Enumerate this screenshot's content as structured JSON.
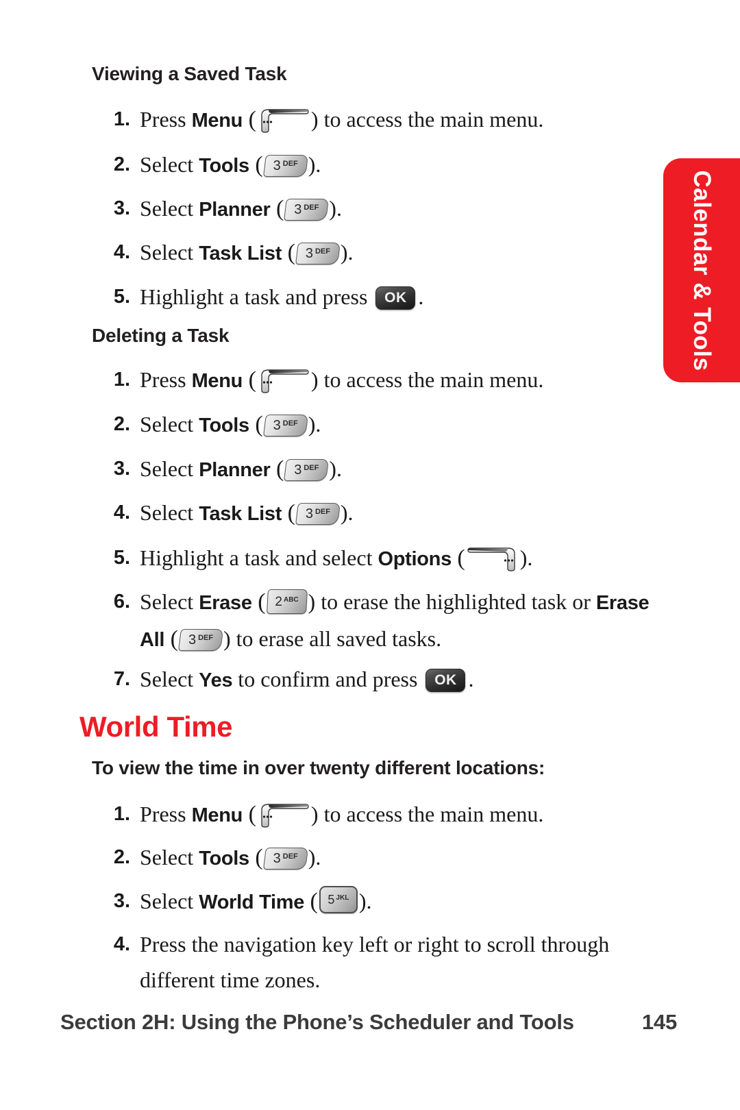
{
  "side_tab": {
    "label": "Calendar & Tools",
    "color": "#ee1c25"
  },
  "sections": [
    {
      "heading": "Viewing a Saved Task",
      "steps": [
        {
          "num": "1.",
          "pre": "Press ",
          "bold": "Menu",
          "mid": " (",
          "key": "soft-left",
          "post": ") to access the main menu."
        },
        {
          "num": "2.",
          "pre": "Select ",
          "bold": "Tools",
          "mid": " (",
          "key": "3DEF",
          "post": ")."
        },
        {
          "num": "3.",
          "pre": "Select ",
          "bold": "Planner",
          "mid": " (",
          "key": "3DEF",
          "post": ")."
        },
        {
          "num": "4.",
          "pre": "Select ",
          "bold": "Task List",
          "mid": " (",
          "key": "3DEF",
          "post": ")."
        },
        {
          "num": "5.",
          "pre": "Highlight a task and press ",
          "bold": "",
          "mid": "",
          "key": "OK",
          "post": "."
        }
      ]
    },
    {
      "heading": "Deleting a Task",
      "steps": [
        {
          "num": "1.",
          "pre": "Press ",
          "bold": "Menu",
          "mid": " (",
          "key": "soft-left",
          "post": ") to access the main menu."
        },
        {
          "num": "2.",
          "pre": "Select ",
          "bold": "Tools",
          "mid": " (",
          "key": "3DEF",
          "post": ")."
        },
        {
          "num": "3.",
          "pre": "Select ",
          "bold": "Planner",
          "mid": " (",
          "key": "3DEF",
          "post": ")."
        },
        {
          "num": "4.",
          "pre": "Select ",
          "bold": "Task List",
          "mid": " (",
          "key": "3DEF",
          "post": ")."
        },
        {
          "num": "5.",
          "pre": "Highlight a task and select ",
          "bold": "Options",
          "mid": " (",
          "key": "soft-right",
          "post": ")."
        },
        {
          "num": "6.",
          "pre": "Select ",
          "bold": "Erase",
          "mid": " (",
          "key": "2ABC",
          "post": ") to erase the highlighted task or ",
          "bold2": "Erase All",
          "mid2": " (",
          "key2": "3DEF",
          "post2": ") to erase all saved tasks."
        },
        {
          "num": "7.",
          "pre": "Select ",
          "bold": "Yes",
          "mid": " to confirm and press ",
          "key": "OK",
          "post": "."
        }
      ]
    }
  ],
  "world_time": {
    "title": "World Time",
    "subheading": "To view the time in over twenty different locations:",
    "steps": [
      {
        "num": "1.",
        "pre": "Press ",
        "bold": "Menu",
        "mid": " (",
        "key": "soft-left",
        "post": ") to access the main menu."
      },
      {
        "num": "2.",
        "pre": "Select ",
        "bold": "Tools",
        "mid": " (",
        "key": "3DEF",
        "post": ")."
      },
      {
        "num": "3.",
        "pre": "Select ",
        "bold": "World Time",
        "mid": " (",
        "key": "5JKL",
        "post": ")."
      },
      {
        "num": "4.",
        "pre": "Press the navigation key left or right to scroll through different time zones.",
        "bold": "",
        "mid": "",
        "key": "",
        "post": ""
      }
    ]
  },
  "keys": {
    "k3": {
      "digit": "3",
      "letters": "DEF"
    },
    "k2": {
      "digit": "2",
      "letters": "ABC"
    },
    "k5": {
      "digit": "5",
      "letters": "JKL"
    },
    "ok": {
      "label": "OK"
    }
  },
  "footer": {
    "title": "Section 2H: Using the Phone’s Scheduler and Tools",
    "page": "145"
  }
}
